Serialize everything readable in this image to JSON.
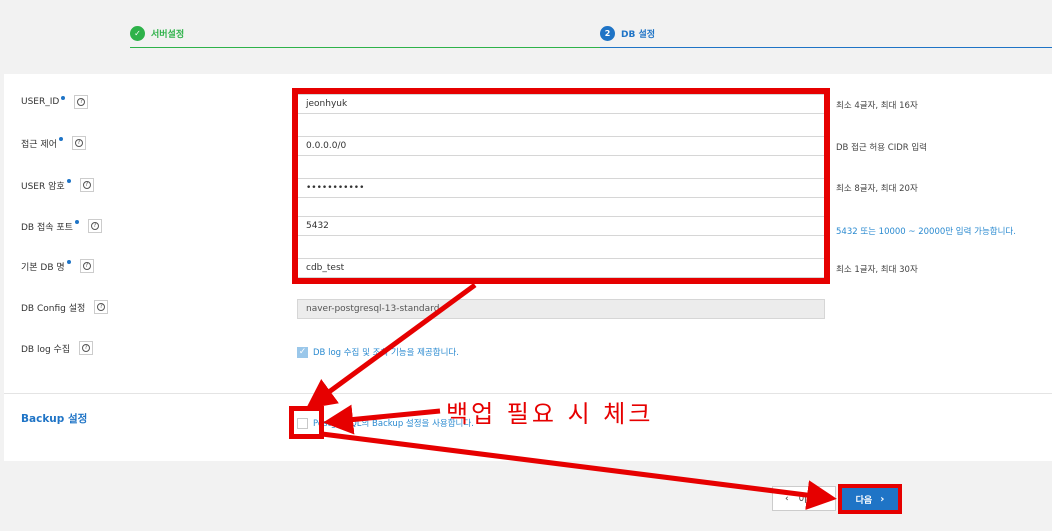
{
  "stepper": {
    "step1": {
      "number": "✓",
      "label": "서버설정"
    },
    "step2": {
      "number": "2",
      "label": "DB 설정"
    }
  },
  "form": {
    "user_id": {
      "label": "USER_ID",
      "value": "jeonhyuk",
      "hint": "최소 4글자, 최대 16자"
    },
    "access": {
      "label": "접근 제어",
      "value": "0.0.0.0/0",
      "hint": "DB 접근 허용 CIDR 입력"
    },
    "password": {
      "label": "USER 암호",
      "value": "•••••••••••",
      "hint": "최소 8글자, 최대 20자"
    },
    "port": {
      "label": "DB 접속 포트",
      "value": "5432",
      "hint": "5432 또는 10000 ~ 20000만 입력 가능합니다."
    },
    "db_name": {
      "label": "기본 DB 명",
      "value": "cdb_test",
      "hint": "최소 1글자, 최대 30자"
    },
    "db_config": {
      "label": "DB Config 설정",
      "value": "naver-postgresql-13-standard"
    },
    "db_log": {
      "label": "DB log 수집",
      "checkbox_label": "DB log 수집 및 조회 기능을 제공합니다.",
      "checked": true
    }
  },
  "backup": {
    "title": "Backup 설정",
    "checkbox_label": "PostgreSQL의 Backup 설정을 사용합니다.",
    "checked": false
  },
  "buttons": {
    "prev": "이전",
    "next": "다음"
  },
  "annotation": {
    "text": "백업 필요 시 체크",
    "color": "#e60000"
  },
  "colors": {
    "accent": "#1f74c6",
    "success": "#2eb24a",
    "annotation": "#e60000"
  },
  "help_icon": "?"
}
